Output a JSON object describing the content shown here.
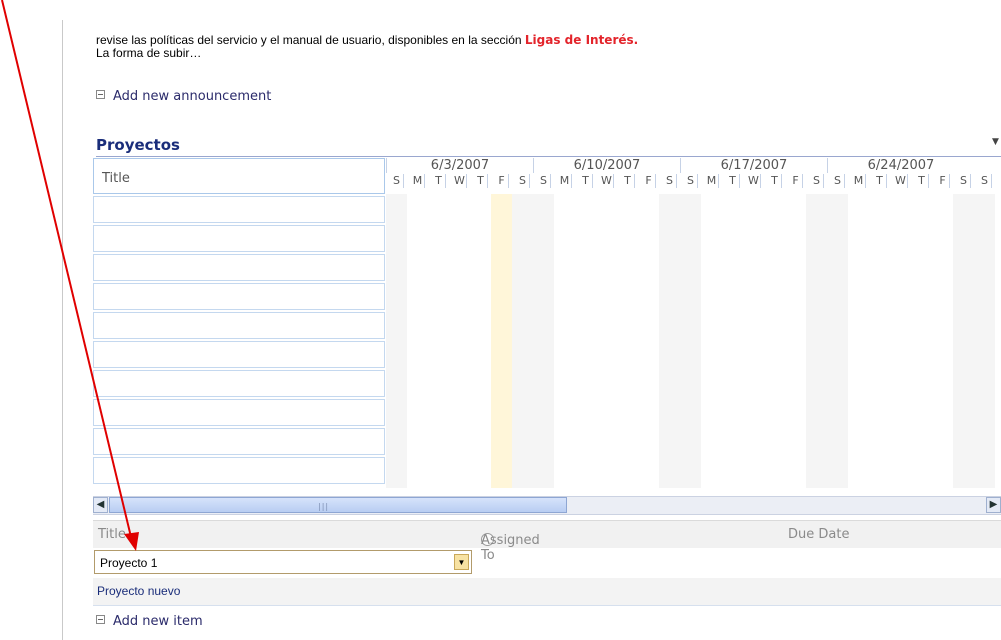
{
  "announcement": {
    "line1": "revise las políticas del servicio y el manual de usuario, disponibles en la sección ",
    "link": "Ligas de Interés.",
    "line2": "La forma de subir…",
    "add_label": "Add new announcement"
  },
  "projects": {
    "title": "Proyectos",
    "title_col_header": "Title",
    "weeks": [
      "6/3/2007",
      "6/10/2007",
      "6/17/2007",
      "6/24/2007"
    ],
    "day_letters": [
      "S",
      "M",
      "T",
      "W",
      "T",
      "F",
      "S"
    ],
    "extra_day": "S",
    "list_headers": {
      "title": "Title",
      "assigned_to": "Assigned To",
      "due_date": "Due Date"
    },
    "selected_project": "Proyecto 1",
    "new_project_row": "Proyecto nuevo",
    "add_item_label": "Add new item"
  },
  "icons": {
    "menu": "dropdown-arrow-icon",
    "scroll_left": "scroll-left-icon",
    "scroll_right": "scroll-right-icon",
    "add": "add-square-icon"
  },
  "colors": {
    "title_blue": "#1a2d7a",
    "link_red": "#e3242b",
    "arrow_red": "#e00000",
    "today_highlight": "#fff6d9",
    "weekend_shade": "#f5f5f5"
  }
}
